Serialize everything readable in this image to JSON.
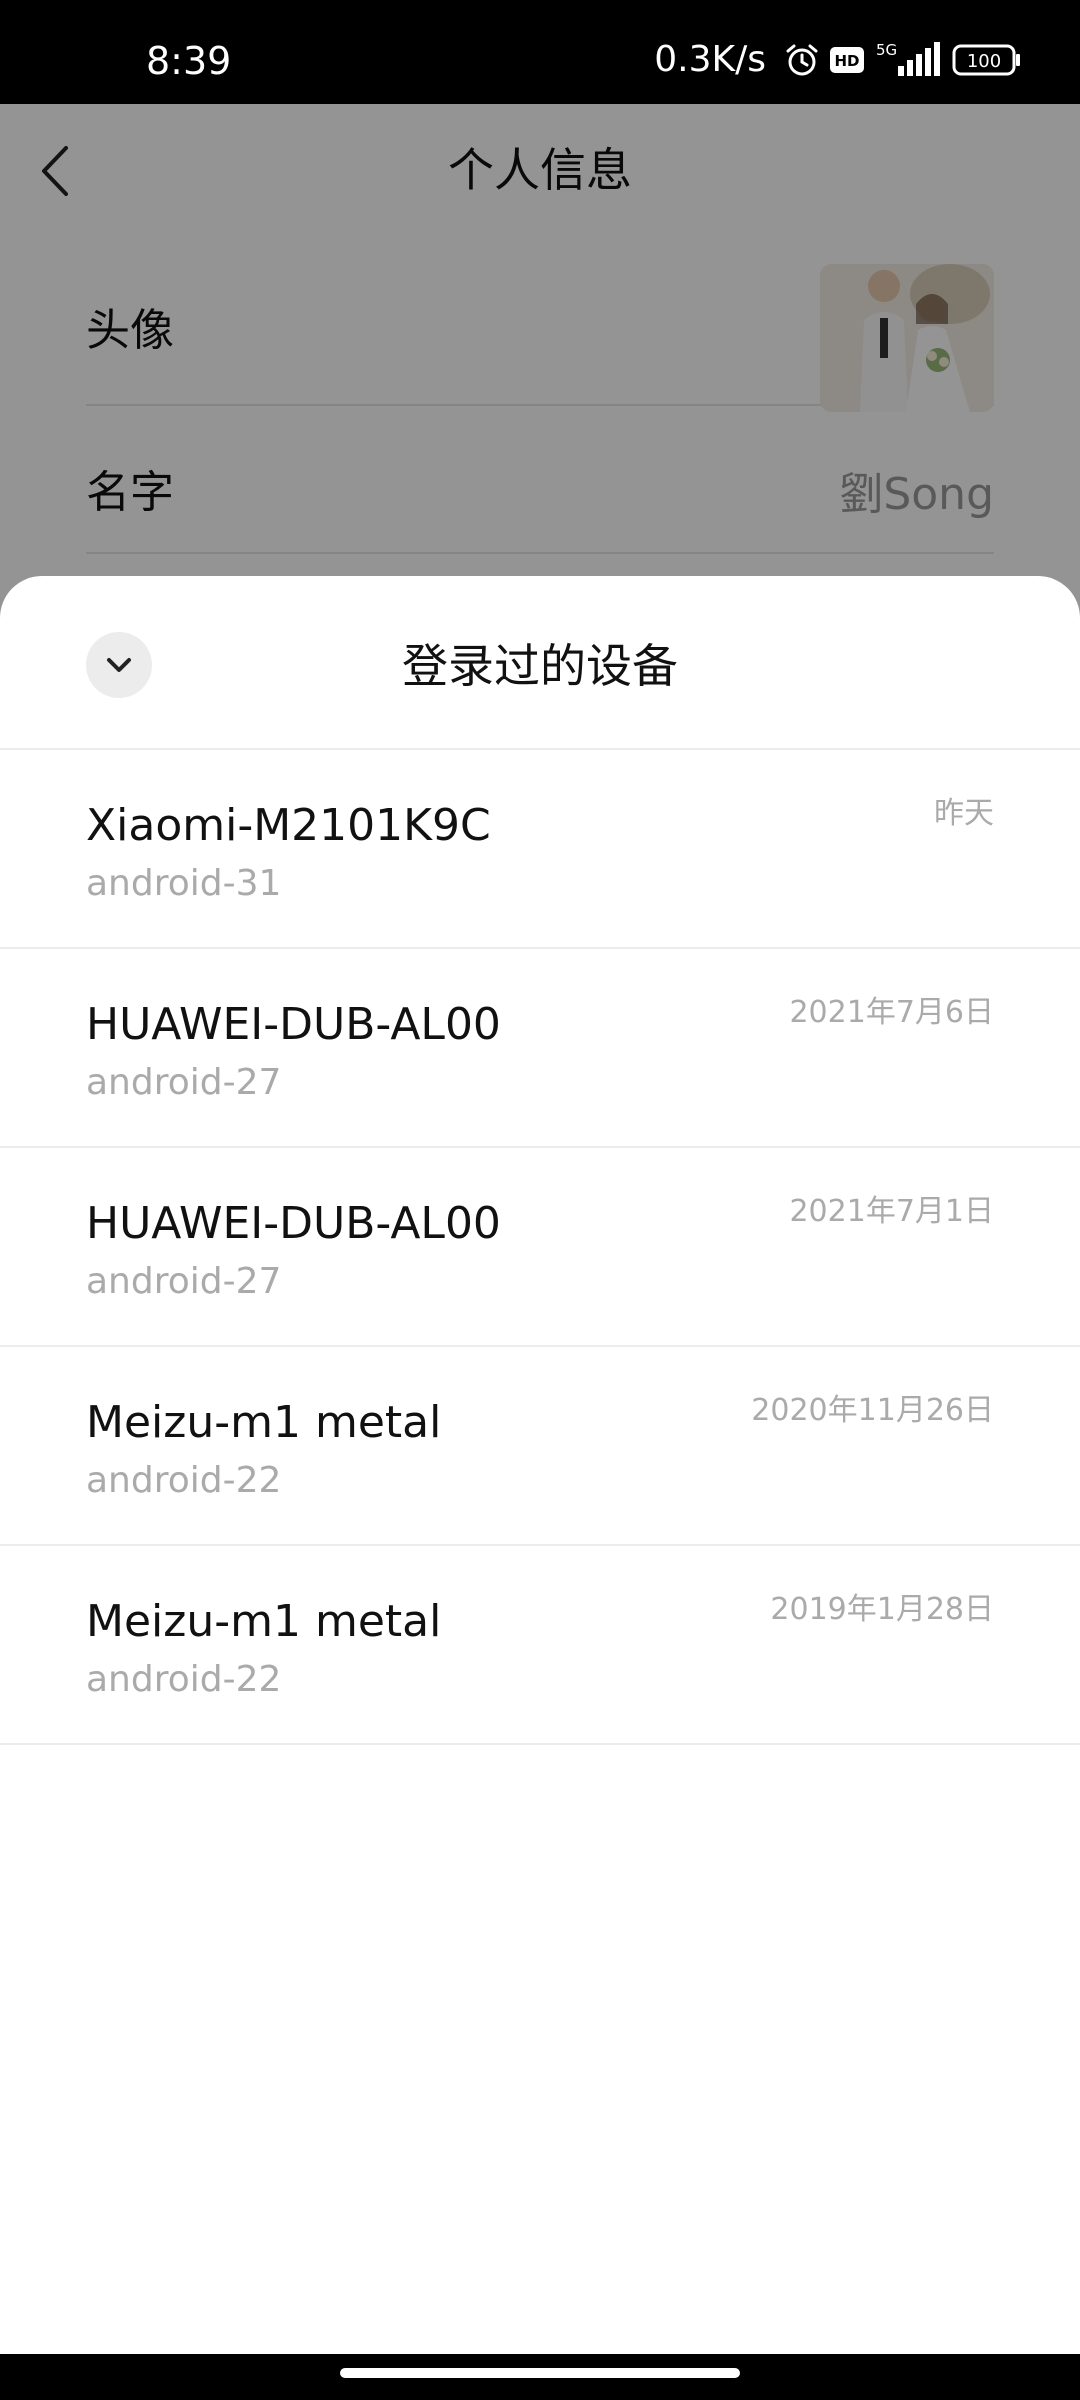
{
  "status_bar": {
    "time": "8:39",
    "net_speed": "0.3K/s",
    "hd_badge": "HD",
    "network_type": "5G",
    "battery": "100"
  },
  "background_page": {
    "title": "个人信息",
    "rows": {
      "avatar_label": "头像",
      "name_label": "名字",
      "name_value": "劉Song"
    }
  },
  "sheet": {
    "title": "登录过的设备",
    "devices": [
      {
        "name": "Xiaomi-M2101K9C",
        "os": "android-31",
        "date": "昨天"
      },
      {
        "name": "HUAWEI-DUB-AL00",
        "os": "android-27",
        "date": "2021年7月6日"
      },
      {
        "name": "HUAWEI-DUB-AL00",
        "os": "android-27",
        "date": "2021年7月1日"
      },
      {
        "name": "Meizu-m1 metal",
        "os": "android-22",
        "date": "2020年11月26日"
      },
      {
        "name": "Meizu-m1 metal",
        "os": "android-22",
        "date": "2019年1月28日"
      }
    ]
  },
  "icons": {
    "back": "chevron-left-icon",
    "collapse": "chevron-down-icon",
    "alarm": "alarm-icon",
    "signal": "signal-icon",
    "battery": "battery-icon"
  },
  "colors": {
    "primary_text": "#111111",
    "secondary_text": "#aaaaaa",
    "overlay": "rgba(0,0,0,0.42)"
  }
}
